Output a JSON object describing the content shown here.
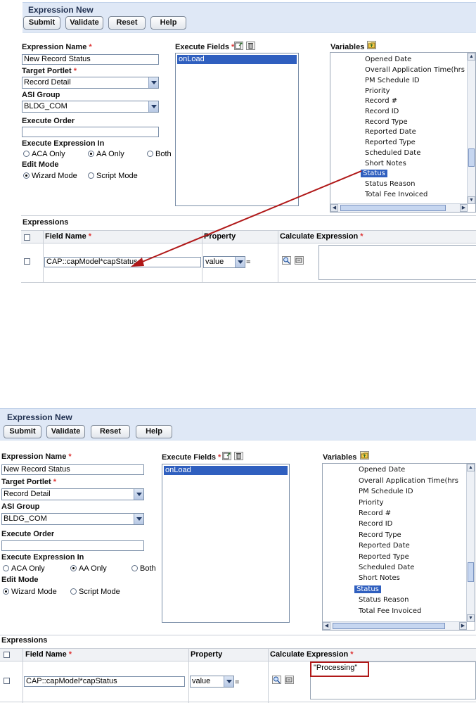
{
  "form": {
    "title": "Expression New",
    "buttons": {
      "submit": "Submit",
      "validate": "Validate",
      "reset": "Reset",
      "help": "Help"
    },
    "expression_name": {
      "label": "Expression Name",
      "required": "*",
      "value": "New Record Status"
    },
    "target_portlet": {
      "label": "Target Portlet",
      "required": "*",
      "value": "Record Detail"
    },
    "asi_group": {
      "label": "ASI Group",
      "value": "BLDG_COM"
    },
    "execute_order": {
      "label": "Execute Order",
      "value": ""
    },
    "execute_in": {
      "label": "Execute Expression In",
      "options": [
        "ACA Only",
        "AA Only",
        "Both"
      ],
      "selected": "AA Only"
    },
    "edit_mode": {
      "label": "Edit Mode",
      "options": [
        "Wizard Mode",
        "Script Mode"
      ],
      "selected": "Wizard Mode"
    },
    "execute_fields": {
      "label": "Execute Fields",
      "required": "*",
      "items": [
        "onLoad"
      ]
    },
    "variables": {
      "label": "Variables",
      "items": [
        "Opened Date",
        "Overall Application Time(hrs",
        "PM Schedule ID",
        "Priority",
        "Record #",
        "Record ID",
        "Record Type",
        "Reported Date",
        "Reported Type",
        "Scheduled Date",
        "Short Notes",
        "Status",
        "Status Reason",
        "Total Fee Invoiced"
      ],
      "selected": "Status"
    },
    "expressions": {
      "label": "Expressions",
      "columns": {
        "field_name": "Field Name",
        "property": "Property",
        "calculate": "Calculate Expression"
      },
      "required": "*",
      "row": {
        "field_name": "CAP::capModel*capStatus",
        "property": "value",
        "operator": "="
      }
    },
    "after_value": "\"Processing\""
  },
  "icons": [
    "add-field-icon",
    "delete-icon",
    "variables-folder-icon",
    "search-icon",
    "clear-icon"
  ],
  "colors": {
    "selection": "#2f5fbf",
    "arrow": "#b01818",
    "highlight_box": "#b01818",
    "titlebar": "#dfe8f6"
  }
}
